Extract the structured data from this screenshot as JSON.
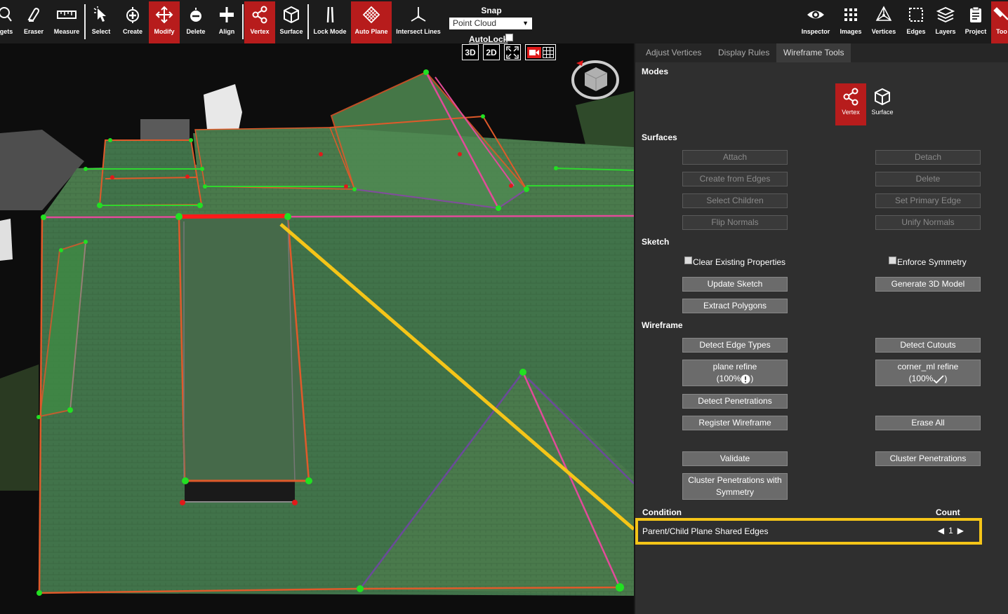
{
  "toolbar": {
    "tools": [
      {
        "label": "gets",
        "icon": "wand-icon"
      },
      {
        "label": "Eraser",
        "icon": "eraser-icon"
      },
      {
        "label": "Measure",
        "icon": "ruler-icon"
      },
      {
        "label": "Select",
        "icon": "cursor-icon"
      },
      {
        "label": "Create",
        "icon": "create-plus-icon"
      },
      {
        "label": "Modify",
        "icon": "move-arrows-icon",
        "active": true
      },
      {
        "label": "Delete",
        "icon": "delete-icon"
      },
      {
        "label": "Align",
        "icon": "align-icon"
      },
      {
        "label": "Vertex",
        "icon": "vertex-icon",
        "active": true
      },
      {
        "label": "Surface",
        "icon": "cube-icon"
      },
      {
        "label": "Lock Mode",
        "icon": "lock-mode-icon"
      },
      {
        "label": "Auto Plane",
        "icon": "auto-plane-icon",
        "active": true
      },
      {
        "label": "Intersect Lines",
        "icon": "intersect-lines-icon"
      }
    ],
    "snap": {
      "title": "Snap",
      "value": "Point Cloud",
      "arrow": "▼"
    },
    "autolock": "AutoLock",
    "right_tools": [
      {
        "label": "Inspector",
        "icon": "eye-icon"
      },
      {
        "label": "Images",
        "icon": "grid-icon"
      },
      {
        "label": "Vertices",
        "icon": "vertices-icon"
      },
      {
        "label": "Edges",
        "icon": "edges-icon"
      },
      {
        "label": "Layers",
        "icon": "layers-icon"
      },
      {
        "label": "Project",
        "icon": "clipboard-icon"
      },
      {
        "label": "Too",
        "icon": "tools-icon",
        "active": true
      }
    ]
  },
  "view": {
    "btn_3d": "3D",
    "btn_2d": "2D"
  },
  "panel": {
    "tabs": [
      "Adjust Vertices",
      "Display Rules",
      "Wireframe Tools"
    ],
    "active_tab": "Wireframe Tools",
    "modes": {
      "title": "Modes",
      "vertex": "Vertex",
      "surface": "Surface"
    },
    "surfaces": {
      "title": "Surfaces",
      "attach": "Attach",
      "detach": "Detach",
      "create_from_edges": "Create from Edges",
      "delete": "Delete",
      "select_children": "Select Children",
      "set_primary_edge": "Set Primary Edge",
      "flip_normals": "Flip Normals",
      "unify_normals": "Unify Normals"
    },
    "sketch": {
      "title": "Sketch",
      "clear_existing": "Clear Existing Properties",
      "enforce_symmetry": "Enforce Symmetry",
      "update_sketch": "Update Sketch",
      "generate_3d": "Generate 3D Model",
      "extract_polygons": "Extract Polygons"
    },
    "wireframe": {
      "title": "Wireframe",
      "detect_edge_types": "Detect Edge Types",
      "detect_cutouts": "Detect Cutouts",
      "plane_refine_1": "plane refine",
      "plane_refine_2a": "(100% ",
      "plane_refine_2b": ")",
      "corner_refine_1": "corner_ml refine",
      "corner_refine_2a": "(100% ",
      "corner_refine_2b": ")",
      "detect_penetrations": "Detect Penetrations",
      "register_wireframe": "Register Wireframe",
      "erase_all": "Erase All",
      "validate": "Validate",
      "cluster_penetrations": "Cluster Penetrations",
      "cluster_sym_1": "Cluster Penetrations with",
      "cluster_sym_2": "Symmetry"
    },
    "condition": {
      "header": "Condition",
      "count_header": "Count",
      "row_name": "Parent/Child Plane Shared Edges",
      "count": "1",
      "prev": "◀",
      "next": "▶"
    }
  },
  "colors": {
    "accent_red": "#b71c1c",
    "highlight_yellow": "#f5c518",
    "roof_green": "#3f7045"
  }
}
